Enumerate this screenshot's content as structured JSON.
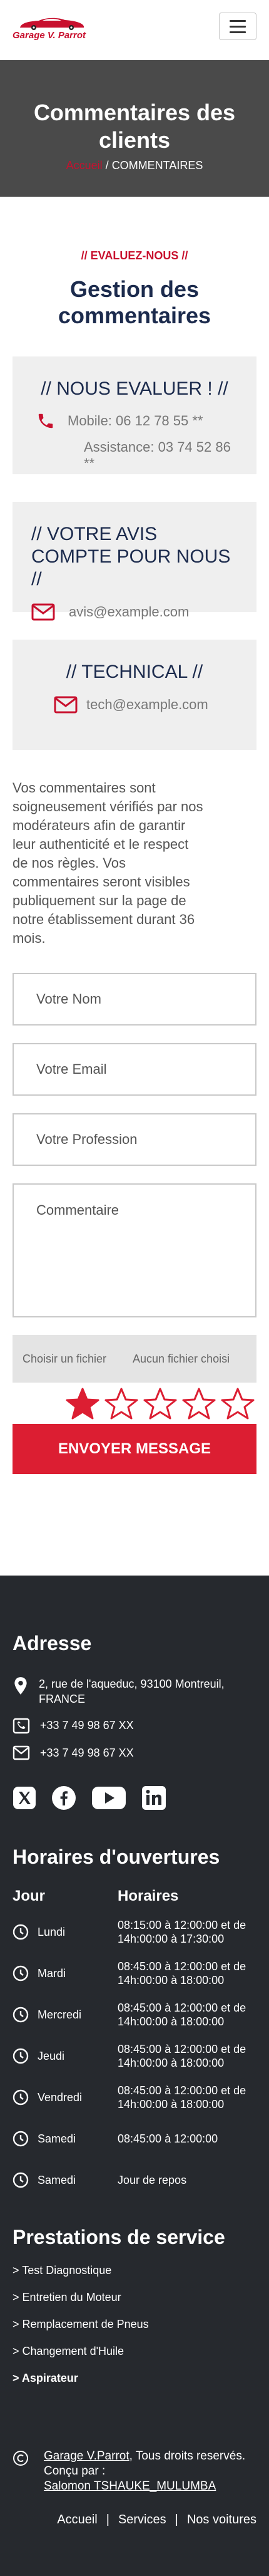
{
  "header": {
    "logo_text": "Garage V. Parrot",
    "menu_icon": "hamburger-menu-icon"
  },
  "hero": {
    "title": "Commentaires des clients",
    "breadcrumb_home": "Accueil",
    "breadcrumb_sep": " / ",
    "breadcrumb_current": "COMMENTAIRES"
  },
  "main": {
    "eyebrow": "// EVALUEZ-NOUS //",
    "title": "Gestion des commentaires",
    "cards": [
      {
        "title": "// NOUS EVALUER ! //",
        "lines": [
          "Mobile: 06 12 78 55 **",
          "Assistance: 03 74 52 86 **"
        ]
      },
      {
        "title": "// VOTRE AVIS COMPTE POUR NOUS //",
        "lines": [
          "avis@example.com"
        ]
      },
      {
        "title": "// TECHNICAL //",
        "lines": [
          "tech@example.com"
        ]
      }
    ],
    "intro": "Vos commentaires sont soigneusement vérifiés par nos modérateurs afin de garantir leur authenticité et le respect de nos règles. Vos commentaires seront visibles publiquement sur la page de notre établissement durant 36 mois."
  },
  "form": {
    "name_placeholder": "Votre Nom",
    "email_placeholder": "Votre Email",
    "profession_placeholder": "Votre Profession",
    "comment_placeholder": "Commentaire",
    "file_button": "Choisir un fichier",
    "file_status": "Aucun fichier choisi",
    "rating": 1,
    "rating_max": 5,
    "submit_label": "ENVOYER MESSAGE",
    "accent_color": "#dc1e32"
  },
  "footer": {
    "address_title": "Adresse",
    "address": "2, rue de l'aqueduc, 93100 Montreuil, FRANCE",
    "phone": "+33 7 49 98 67 XX",
    "email": "+33 7 49 98 67 XX",
    "hours_title": "Horaires d'ouvertures",
    "hours_col_day": "Jour",
    "hours_col_time": "Horaires",
    "hours": [
      {
        "day": "Lundi",
        "time": "08:15:00 à 12:00:00 et de 14h:00:00 à 17:30:00"
      },
      {
        "day": "Mardi",
        "time": "08:45:00 à 12:00:00 et de 14h:00:00 à 18:00:00"
      },
      {
        "day": "Mercredi",
        "time": "08:45:00 à 12:00:00 et de 14h:00:00 à 18:00:00"
      },
      {
        "day": "Jeudi",
        "time": "08:45:00 à 12:00:00 et de 14h:00:00 à 18:00:00"
      },
      {
        "day": "Vendredi",
        "time": "08:45:00 à 12:00:00 et de 14h:00:00 à 18:00:00"
      },
      {
        "day": "Samedi",
        "time": "08:45:00 à 12:00:00"
      },
      {
        "day": "Samedi",
        "time": "Jour de repos"
      }
    ],
    "services_title": "Prestations de service",
    "services": [
      "> Test Diagnostique",
      "> Entretien du Moteur",
      "> Remplacement de Pneus",
      "> Changement d'Huile",
      "> Aspirateur"
    ],
    "copyright_link": "Garage V.Parrot",
    "copyright_rest": ", Tous droits reservés.",
    "designed_by": "Conçu par :",
    "designer_link": "Salomon TSHAUKE_MULUMBA",
    "nav": [
      "Accueil",
      "Services",
      "Nos voitures"
    ],
    "nav_sep": "|"
  }
}
